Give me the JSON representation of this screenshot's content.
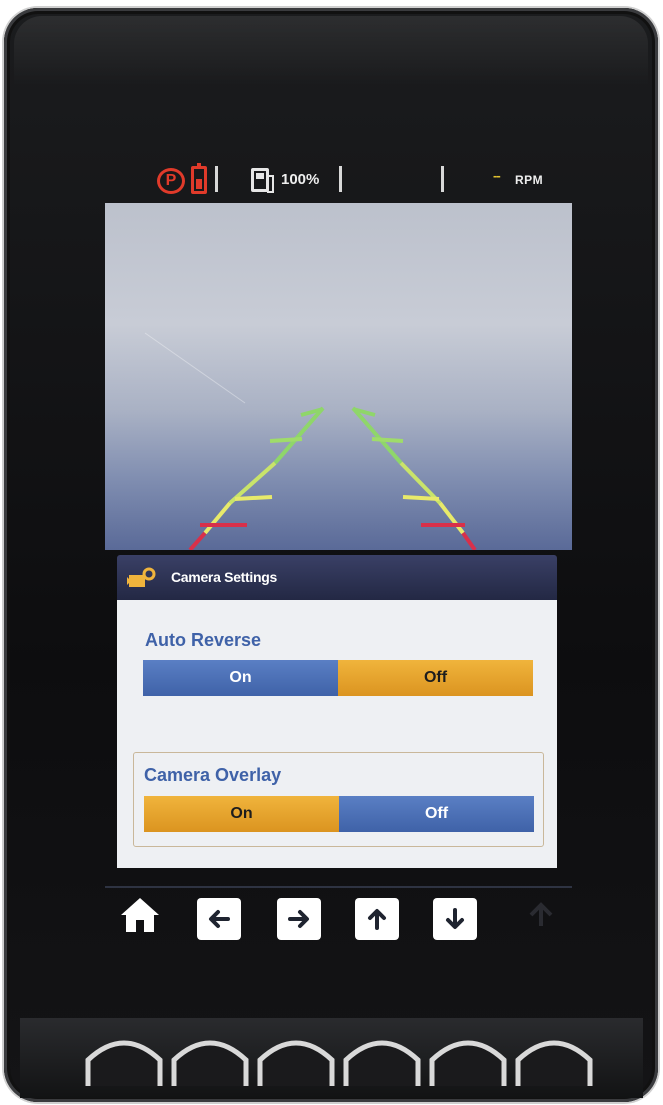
{
  "status": {
    "fuel_level": "100%",
    "rpm_value": "--",
    "rpm_label": "RPM",
    "park_brake_icon": "park-brake-icon",
    "battery_icon": "battery-icon",
    "fuel_icon": "fuel-pump-icon"
  },
  "panel": {
    "title": "Camera Settings",
    "icon": "camera-settings-icon"
  },
  "settings": [
    {
      "label": "Auto Reverse",
      "on_label": "On",
      "off_label": "Off",
      "selected": "Off"
    },
    {
      "label": "Camera Overlay",
      "on_label": "On",
      "off_label": "Off",
      "selected": "On"
    }
  ],
  "nav": {
    "buttons": [
      "home-icon",
      "arrow-left-icon",
      "arrow-right-icon",
      "arrow-up-icon",
      "arrow-down-icon"
    ]
  },
  "colors": {
    "accent_orange": "#e7a532",
    "accent_blue": "#4a6db4",
    "alert_red": "#e03a2a",
    "overlay_green": "#8fd66a",
    "overlay_yellow": "#e8ea6a",
    "overlay_red": "#d8304a"
  }
}
